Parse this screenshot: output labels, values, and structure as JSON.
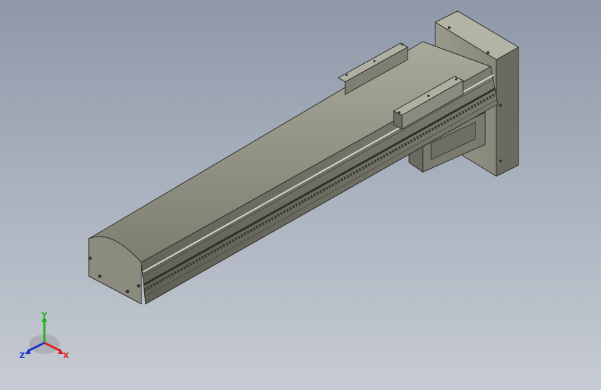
{
  "viewport": {
    "background_top": "#8f98a8",
    "background_bottom": "#c6cbd3",
    "model_color": "#8a8a7c",
    "model_shadow": "#5e5e54",
    "edge_color": "#2a2a26"
  },
  "triad": {
    "x_label": "X",
    "y_label": "Y",
    "z_label": "Z",
    "x_color": "#e02020",
    "y_color": "#20b020",
    "z_color": "#2030d0"
  }
}
